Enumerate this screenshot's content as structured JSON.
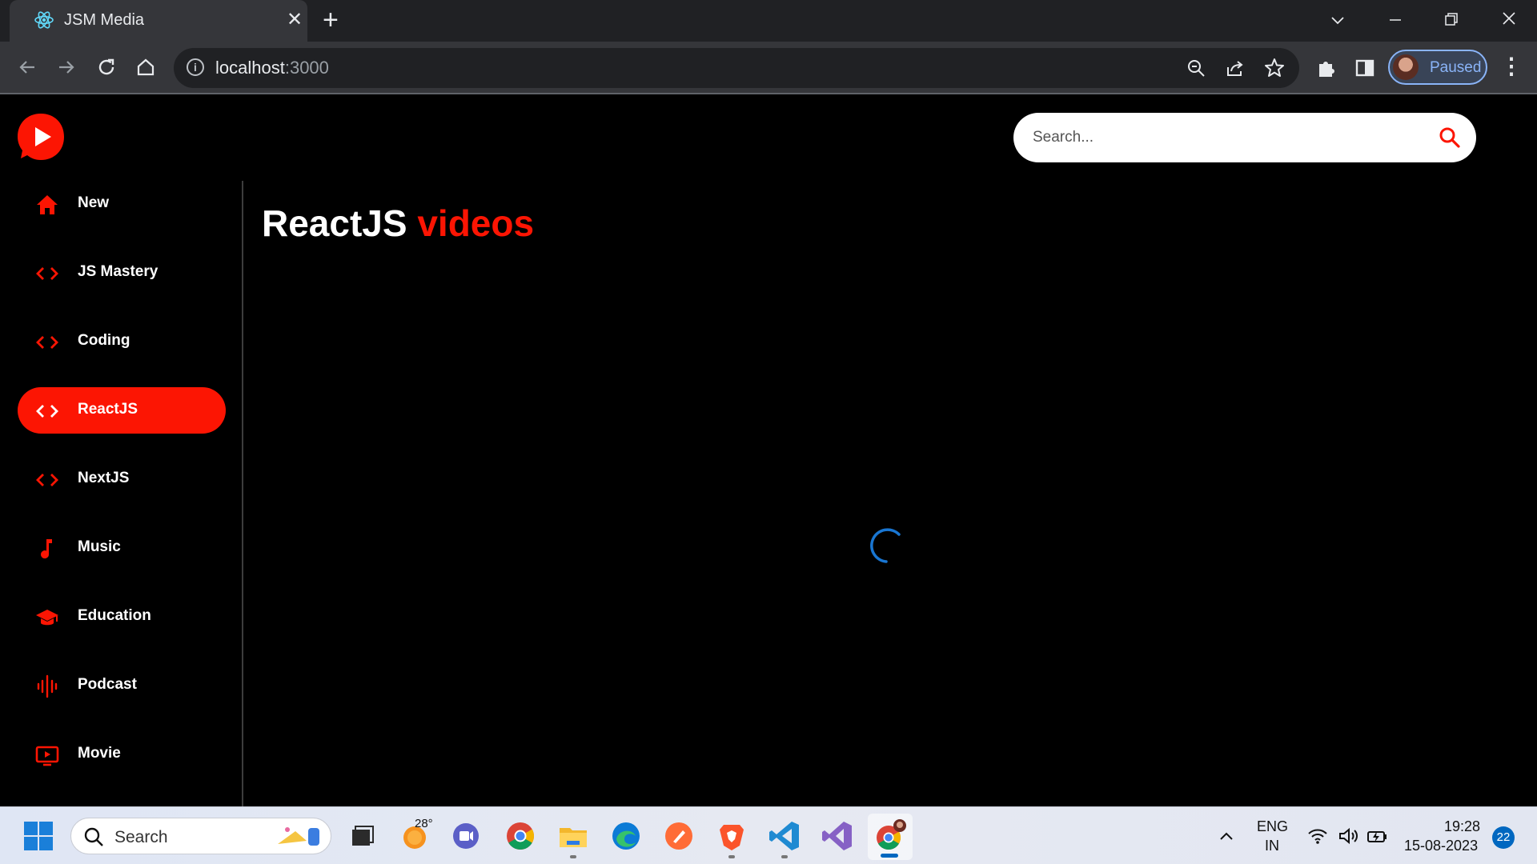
{
  "browser": {
    "tab_title": "JSM Media",
    "tab_close": "✕",
    "new_tab": "+",
    "url_host": "localhost",
    "url_port": ":3000",
    "profile_label": "Paused"
  },
  "app": {
    "search_placeholder": "Search...",
    "sidebar": {
      "selected": "ReactJS",
      "items": [
        {
          "label": "New",
          "icon": "home-icon"
        },
        {
          "label": "JS Mastery",
          "icon": "code-icon"
        },
        {
          "label": "Coding",
          "icon": "code-icon"
        },
        {
          "label": "ReactJS",
          "icon": "code-icon"
        },
        {
          "label": "NextJS",
          "icon": "code-icon"
        },
        {
          "label": "Music",
          "icon": "music-note-icon"
        },
        {
          "label": "Education",
          "icon": "graduation-cap-icon"
        },
        {
          "label": "Podcast",
          "icon": "soundwave-icon"
        },
        {
          "label": "Movie",
          "icon": "tv-icon"
        }
      ]
    },
    "feed_title": {
      "main": "ReactJS",
      "accent": "videos"
    },
    "loading": true
  },
  "taskbar": {
    "search_label": "Search",
    "weather_temp": "28°",
    "lang_line1": "ENG",
    "lang_line2": "IN",
    "time": "19:28",
    "date": "15-08-2023",
    "notifications": "22"
  },
  "colors": {
    "accent": "#fc1503",
    "spinner": "#1976d2",
    "chrome_dark": "#202124",
    "chrome_toolbar": "#35363a"
  }
}
